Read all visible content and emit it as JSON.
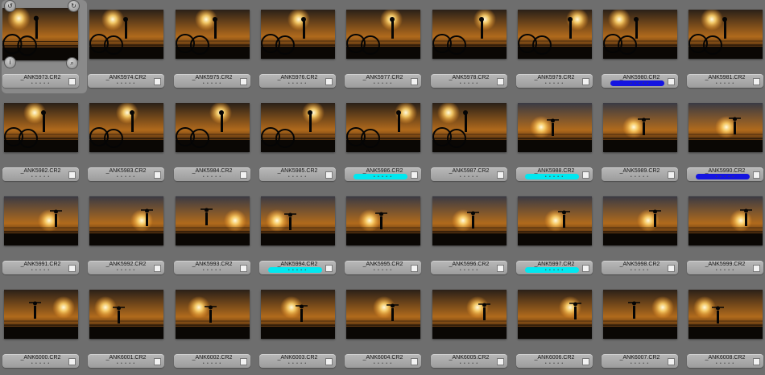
{
  "browser": {
    "selected_index": 0,
    "thumbnails": [
      {
        "filename": "_ANK5973.CR2",
        "rating": "• • • • •",
        "label": "",
        "scene": "bike"
      },
      {
        "filename": "_ANK5974.CR2",
        "rating": "• • • • •",
        "label": "",
        "scene": "bike"
      },
      {
        "filename": "_ANK5975.CR2",
        "rating": "• • • • •",
        "label": "",
        "scene": "bike"
      },
      {
        "filename": "_ANK5976.CR2",
        "rating": "• • • • •",
        "label": "",
        "scene": "bike"
      },
      {
        "filename": "_ANK5977.CR2",
        "rating": "• • • • •",
        "label": "",
        "scene": "bike"
      },
      {
        "filename": "_ANK5978.CR2",
        "rating": "• • • • •",
        "label": "",
        "scene": "bike"
      },
      {
        "filename": "_ANK5979.CR2",
        "rating": "• • • • •",
        "label": "",
        "scene": "bike"
      },
      {
        "filename": "_ANK5980.CR2",
        "rating": "• • • • •",
        "label": "blue",
        "scene": "bike"
      },
      {
        "filename": "_ANK5981.CR2",
        "rating": "• • • • •",
        "label": "",
        "scene": "bike"
      },
      {
        "filename": "_ANK5982.CR2",
        "rating": "• • • • •",
        "label": "",
        "scene": "bike"
      },
      {
        "filename": "_ANK5983.CR2",
        "rating": "• • • • •",
        "label": "",
        "scene": "bike"
      },
      {
        "filename": "_ANK5984.CR2",
        "rating": "• • • • •",
        "label": "",
        "scene": "bike"
      },
      {
        "filename": "_ANK5985.CR2",
        "rating": "• • • • •",
        "label": "",
        "scene": "bike"
      },
      {
        "filename": "_ANK5986.CR2",
        "rating": "• • • • •",
        "label": "cyan",
        "scene": "bike"
      },
      {
        "filename": "_ANK5987.CR2",
        "rating": "• • • • •",
        "label": "",
        "scene": "bike"
      },
      {
        "filename": "_ANK5988.CR2",
        "rating": "• • • • •",
        "label": "cyan",
        "scene": "sky"
      },
      {
        "filename": "_ANK5989.CR2",
        "rating": "• • • • •",
        "label": "",
        "scene": "sky"
      },
      {
        "filename": "_ANK5990.CR2",
        "rating": "• • • • •",
        "label": "blue",
        "scene": "sky"
      },
      {
        "filename": "_ANK5991.CR2",
        "rating": "• • • • •",
        "label": "",
        "scene": "sky"
      },
      {
        "filename": "_ANK5992.CR2",
        "rating": "• • • • •",
        "label": "",
        "scene": "sky"
      },
      {
        "filename": "_ANK5993.CR2",
        "rating": "• • • • •",
        "label": "",
        "scene": "sky"
      },
      {
        "filename": "_ANK5994.CR2",
        "rating": "• • • • •",
        "label": "cyan",
        "scene": "sky"
      },
      {
        "filename": "_ANK5995.CR2",
        "rating": "• • • • •",
        "label": "",
        "scene": "sky"
      },
      {
        "filename": "_ANK5996.CR2",
        "rating": "• • • • •",
        "label": "",
        "scene": "sky"
      },
      {
        "filename": "_ANK5997.CR2",
        "rating": "• • • • •",
        "label": "cyan",
        "scene": "sky"
      },
      {
        "filename": "_ANK5998.CR2",
        "rating": "• • • • •",
        "label": "",
        "scene": "sky"
      },
      {
        "filename": "_ANK5999.CR2",
        "rating": "• • • • •",
        "label": "",
        "scene": "sky"
      },
      {
        "filename": "_ANK6000.CR2",
        "rating": "• • • • •",
        "label": "",
        "scene": "sunset"
      },
      {
        "filename": "_ANK6001.CR2",
        "rating": "• • • • •",
        "label": "",
        "scene": "sunset"
      },
      {
        "filename": "_ANK6002.CR2",
        "rating": "• • • • •",
        "label": "",
        "scene": "sunset"
      },
      {
        "filename": "_ANK6003.CR2",
        "rating": "• • • • •",
        "label": "",
        "scene": "sunset"
      },
      {
        "filename": "_ANK6004.CR2",
        "rating": "• • • • •",
        "label": "",
        "scene": "sunset"
      },
      {
        "filename": "_ANK6005.CR2",
        "rating": "• • • • •",
        "label": "",
        "scene": "sunset"
      },
      {
        "filename": "_ANK6006.CR2",
        "rating": "• • • • •",
        "label": "",
        "scene": "sunset"
      },
      {
        "filename": "_ANK6007.CR2",
        "rating": "• • • • •",
        "label": "",
        "scene": "sunset"
      },
      {
        "filename": "_ANK6008.CR2",
        "rating": "• • • • •",
        "label": "",
        "scene": "sunset"
      }
    ],
    "overlay_icons": {
      "rotate_left": "rotate-left-icon",
      "rotate_right": "rotate-right-icon",
      "info": "info-icon",
      "zoom": "zoom-icon"
    },
    "overlay_glyphs": {
      "rotate_left": "↺",
      "rotate_right": "↻",
      "info": "i",
      "zoom": "⌕"
    },
    "colors": {
      "background": "#6e6e6e",
      "label_cyan": "#00e8f0",
      "label_blue": "#1414e0"
    }
  }
}
